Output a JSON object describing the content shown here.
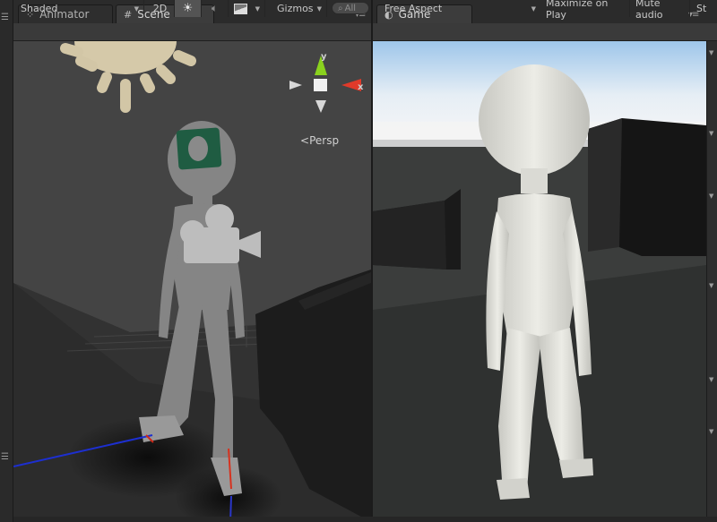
{
  "tabs": {
    "animator": "Animator",
    "scene": "Scene",
    "game": "Game"
  },
  "scene_toolbar": {
    "draw_mode": "Shaded",
    "mode_2d": "2D",
    "gizmos": "Gizmos",
    "search_placeholder": "All"
  },
  "game_toolbar": {
    "aspect": "Free Aspect",
    "maximize_on_play": "Maximize on Play",
    "mute_audio": "Mute audio",
    "stats": "St"
  },
  "scene_view": {
    "projection": "Persp",
    "gizmo_axis_x": "x",
    "gizmo_axis_y": "y"
  },
  "colors": {
    "panel_bg": "#282828",
    "toolbar_bg": "#3a3a3a",
    "axis_x": "#e03a2a",
    "axis_y": "#8ad21e",
    "axis_z": "#2a40d8",
    "sky_top": "#9ec6ea",
    "character": "#e6e6e0"
  }
}
